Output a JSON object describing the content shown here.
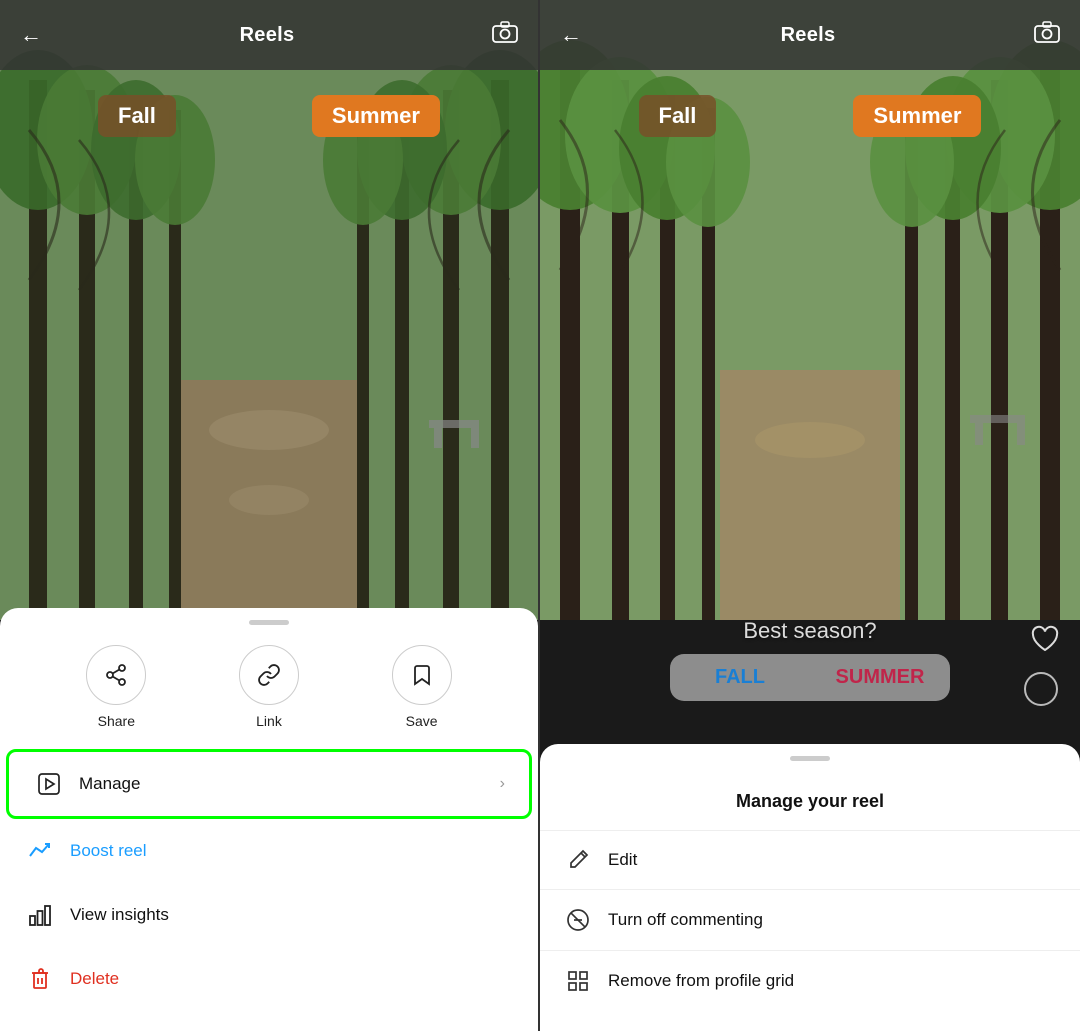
{
  "left_panel": {
    "nav": {
      "back_label": "←",
      "title": "Reels",
      "camera_icon": "camera"
    },
    "season_tags": {
      "fall": "Fall",
      "summer": "Summer"
    },
    "sheet": {
      "handle": "",
      "icon_buttons": [
        {
          "id": "share",
          "icon": "share",
          "label": "Share"
        },
        {
          "id": "link",
          "icon": "link",
          "label": "Link"
        },
        {
          "id": "save",
          "icon": "save",
          "label": "Save"
        }
      ],
      "menu_items": [
        {
          "id": "manage",
          "icon": "manage",
          "label": "Manage",
          "chevron": "›",
          "highlighted": true,
          "color": "default"
        },
        {
          "id": "boost",
          "icon": "boost",
          "label": "Boost reel",
          "chevron": "",
          "color": "blue"
        },
        {
          "id": "insights",
          "icon": "insights",
          "label": "View insights",
          "chevron": "",
          "color": "default"
        },
        {
          "id": "delete",
          "icon": "delete",
          "label": "Delete",
          "chevron": "",
          "color": "red"
        }
      ]
    }
  },
  "right_panel": {
    "nav": {
      "back_label": "←",
      "title": "Reels",
      "camera_icon": "camera"
    },
    "season_tags": {
      "fall": "Fall",
      "summer": "Summer"
    },
    "poll": {
      "question": "Best season?",
      "option_fall": "FALL",
      "option_summer": "SUMMER"
    },
    "manage_sheet": {
      "title": "Manage your reel",
      "items": [
        {
          "id": "edit",
          "icon": "edit",
          "label": "Edit"
        },
        {
          "id": "commenting",
          "icon": "commenting",
          "label": "Turn off commenting"
        },
        {
          "id": "remove-grid",
          "icon": "grid",
          "label": "Remove from profile grid"
        }
      ]
    }
  }
}
